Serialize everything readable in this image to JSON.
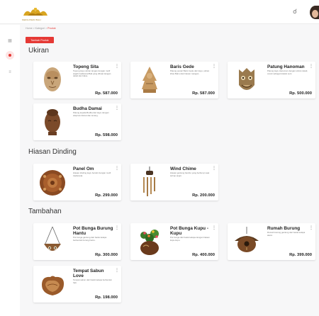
{
  "header": {
    "logo_subtitle": "KERAJINAN BALI",
    "notification_icon": "bell-icon",
    "avatar_icon": "user-avatar"
  },
  "sidebar": {
    "items": [
      {
        "icon": "grid-icon"
      },
      {
        "icon": "product-icon",
        "active": true
      },
      {
        "icon": "list-icon"
      }
    ]
  },
  "breadcrumb": {
    "path": "Home > Kategori > ",
    "current": "Produk"
  },
  "add_button_label": "Tambah Produk",
  "sections": [
    {
      "title": "Ukiran",
      "products": [
        {
          "name": "Topeng Sita",
          "desc": "Topeng kayu ukiran tangan dengan motif wajah tradisional Bali yang dibuat dengan detail dan halus.",
          "price": "Rp. 587.000",
          "icon": "mask-icon"
        },
        {
          "name": "Baris Gede",
          "desc": "Patung penari Baris Gede dari kayu, ukiran khas Bali untuk hiasan ruangan.",
          "price": "Rp. 587.000",
          "icon": "dancer-statue-icon"
        },
        {
          "name": "Patung Hanoman",
          "desc": "Patung kayu Hanoman dengan ukiran detail, cocok sebagai koleksi seni.",
          "price": "Rp. 500.000",
          "icon": "hanoman-mask-icon"
        },
        {
          "name": "Budha Damai",
          "desc": "Patung kepala Budha dari kayu dengan ekspresi damai dan tenang.",
          "price": "Rp. 598.000",
          "icon": "buddha-head-icon"
        }
      ]
    },
    {
      "title": "Hiasan Dinding",
      "products": [
        {
          "name": "Panel Om",
          "desc": "Hiasan dinding kayu berukir dengan motif tradisional.",
          "price": "Rp. 299.000",
          "icon": "wall-panel-icon"
        },
        {
          "name": "Wind Chime",
          "desc": "Hiasan gantung bambu yang berbunyi saat tertiup angin.",
          "price": "Rp. 200.000",
          "icon": "wind-chime-icon"
        }
      ]
    },
    {
      "title": "Tambahan",
      "products": [
        {
          "name": "Pot Bunga Burung Hantu",
          "desc": "Pot bunga gantung dari batok kelapa berbentuk burung hantu.",
          "price": "Rp. 300.000",
          "icon": "hanging-pot-icon"
        },
        {
          "name": "Pot Bunga Kupu - Kupu",
          "desc": "Pot bunga dari batok kelapa dengan hiasan kupu-kupu.",
          "price": "Rp. 400.000",
          "icon": "flower-pot-icon"
        },
        {
          "name": "Rumah Burung",
          "desc": "Rumah burung gantung dari batok kelapa alami.",
          "price": "Rp. 399.000",
          "icon": "bird-house-icon"
        },
        {
          "name": "Tempat Sabun Love",
          "desc": "Tempat sabun dari batok kelapa berbentuk hati.",
          "price": "Rp. 198.000",
          "icon": "soap-dish-icon"
        }
      ]
    }
  ],
  "colors": {
    "accent": "#e53935",
    "background": "#f7f7f8",
    "card": "#ffffff"
  }
}
